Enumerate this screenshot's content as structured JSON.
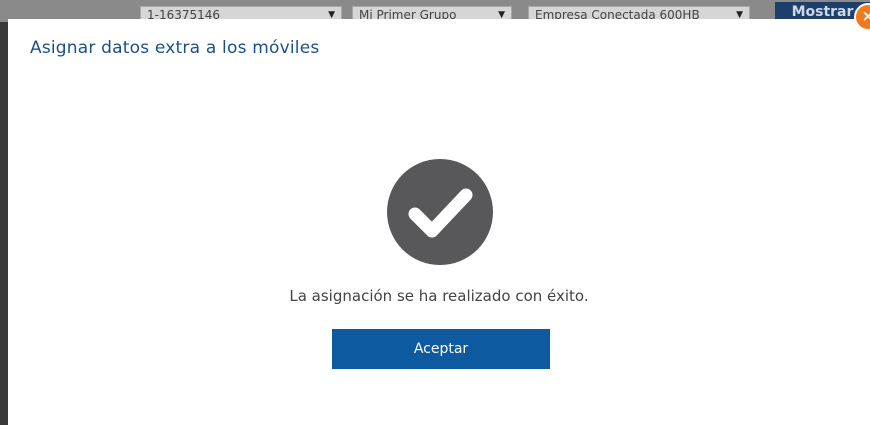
{
  "background": {
    "selects": [
      {
        "value": "1-16375146"
      },
      {
        "value": "Mi Primer Grupo"
      },
      {
        "value": "Empresa Conectada 600HB"
      }
    ],
    "show_button": "Mostrar"
  },
  "dialog": {
    "title": "Asignar datos extra a los móviles",
    "close_icon": "close-icon",
    "success_icon": "checkmark-circle-icon",
    "message": "La asignación se ha realizado con éxito.",
    "accept_label": "Aceptar",
    "colors": {
      "title": "#1d4f8a",
      "accent": "#0d5aa0",
      "icon": "#58585a",
      "close": "#f07b1f"
    }
  }
}
